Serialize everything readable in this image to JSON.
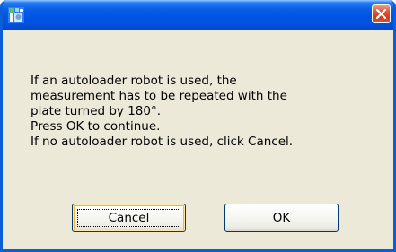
{
  "dialog": {
    "title": "",
    "message_lines": [
      "If an autoloader robot is used, the",
      "measurement has to be repeated with the",
      "plate turned by 180°.",
      "Press OK to continue.",
      "If no autoloader robot is used, click Cancel."
    ],
    "buttons": {
      "cancel_label": "Cancel",
      "ok_label": "OK"
    }
  },
  "titlebar": {
    "icon": "app-icon",
    "close_icon": "close-icon"
  },
  "colors": {
    "titlebar_blue": "#0054e3",
    "window_face": "#ece9d8",
    "close_red": "#d9593a",
    "button_border": "#003c74"
  }
}
